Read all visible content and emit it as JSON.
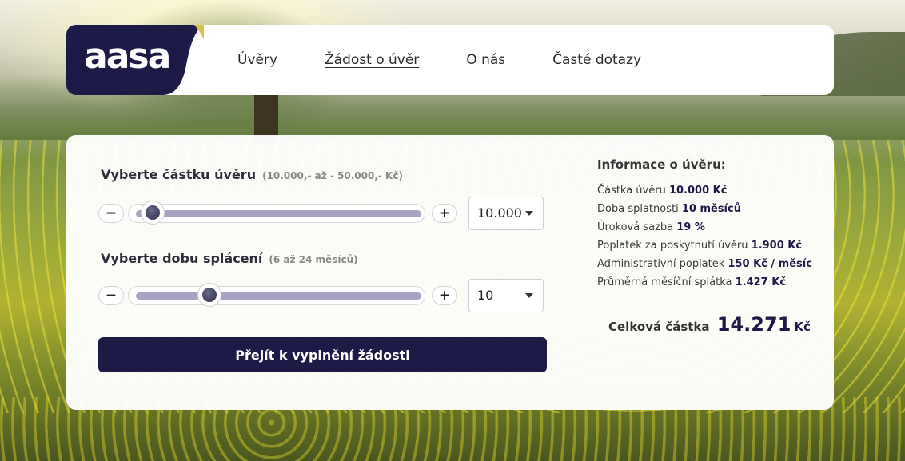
{
  "brand": {
    "logo_text": "aasa",
    "color_primary": "#1e1a48"
  },
  "nav": {
    "items": [
      {
        "label": "Úvěry",
        "active": false
      },
      {
        "label": "Žádost o úvěr",
        "active": true
      },
      {
        "label": "O nás",
        "active": false
      },
      {
        "label": "Časté dotazy",
        "active": false
      }
    ]
  },
  "calculator": {
    "amount": {
      "title": "Vyberte částku úvěru",
      "hint": "(10.000,- až - 50.000,- Kč)",
      "minus": "−",
      "plus": "+",
      "selected": "10.000",
      "slider_fraction": 0.0
    },
    "term": {
      "title": "Vyberte dobu splácení",
      "hint": "(6 až 24 měsíců)",
      "minus": "−",
      "plus": "+",
      "selected": "10",
      "slider_fraction": 0.222
    },
    "submit_label": "Přejít k vyplnění žádosti"
  },
  "info": {
    "title": "Informace o úvěru:",
    "rows": [
      {
        "label": "Částka úvěru",
        "value": "10.000 Kč"
      },
      {
        "label": "Doba splatnosti",
        "value": "10 měsíců"
      },
      {
        "label": "Úroková sazba",
        "value": "19 %"
      },
      {
        "label": "Poplatek za poskytnutí úvěru",
        "value": "1.900 Kč"
      },
      {
        "label": "Administrativní poplatek",
        "value": "150 Kč / měsíc"
      },
      {
        "label": "Průměrná měsíční splátka",
        "value": "1.427 Kč"
      }
    ],
    "total_label": "Celková částka",
    "total_value": "14.271",
    "total_currency": "Kč"
  }
}
